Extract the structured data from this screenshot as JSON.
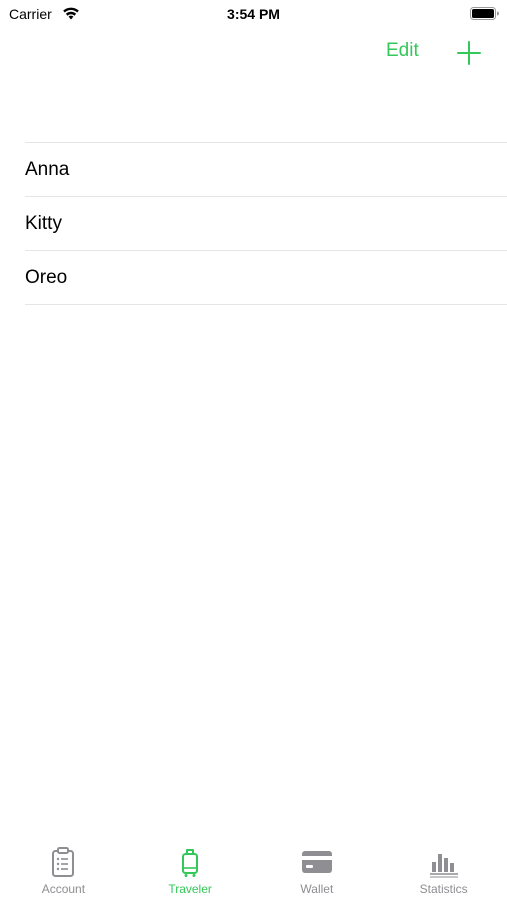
{
  "status_bar": {
    "carrier": "Carrier",
    "time": "3:54 PM"
  },
  "nav": {
    "edit_label": "Edit",
    "add_icon": "plus-icon"
  },
  "travelers": [
    {
      "name": "Anna"
    },
    {
      "name": "Kitty"
    },
    {
      "name": "Oreo"
    }
  ],
  "tabs": [
    {
      "label": "Account",
      "icon": "clipboard-icon",
      "active": false
    },
    {
      "label": "Traveler",
      "icon": "suitcase-icon",
      "active": true
    },
    {
      "label": "Wallet",
      "icon": "card-icon",
      "active": false
    },
    {
      "label": "Statistics",
      "icon": "chart-icon",
      "active": false
    }
  ],
  "colors": {
    "accent": "#34c759",
    "inactive": "#8e8e93",
    "separator": "#e5e5e7"
  }
}
